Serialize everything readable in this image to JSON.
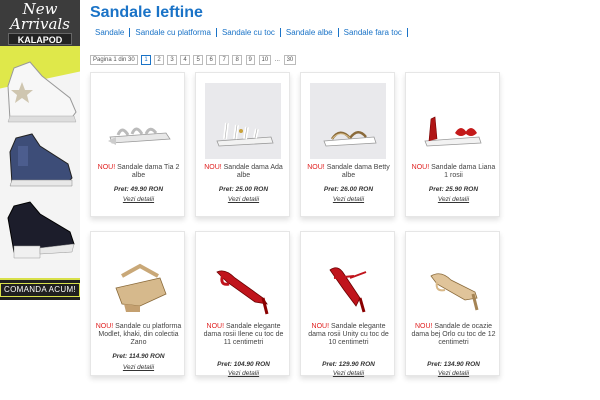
{
  "banner": {
    "title": "New\nArrivals",
    "brand": "KALAPOD",
    "cta": "COMANDA ACUM!"
  },
  "page": {
    "title": "Sandale Ieftine"
  },
  "nav": {
    "links": [
      "Sandale",
      "Sandale cu platforma",
      "Sandale cu toc",
      "Sandale albe",
      "Sandale fara toc"
    ]
  },
  "pager": {
    "label": "Pagina 1 din 30",
    "pages": [
      "1",
      "2",
      "3",
      "4",
      "5",
      "6",
      "7",
      "8",
      "9",
      "10"
    ],
    "dots": "...",
    "last": "30",
    "current": "1"
  },
  "products": [
    {
      "nou": "NOU!",
      "name": "Sandale dama Tia 2 albe",
      "price": "Pret: 49.90 RON",
      "details": "Vezi detalii"
    },
    {
      "nou": "NOU!",
      "name": "Sandale dama Ada albe",
      "price": "Pret: 25.00 RON",
      "details": "Vezi detalii"
    },
    {
      "nou": "NOU!",
      "name": "Sandale dama Betty albe",
      "price": "Pret: 26.00 RON",
      "details": "Vezi detalii"
    },
    {
      "nou": "NOU!",
      "name": "Sandale dama Liana 1 rosii",
      "price": "Pret: 25.90 RON",
      "details": "Vezi detalii"
    },
    {
      "nou": "NOU!",
      "name": "Sandale cu platforma Modlet, khaki, din colectia Zano",
      "price": "Pret: 114.90 RON",
      "details": "Vezi detalii"
    },
    {
      "nou": "NOU!",
      "name": "Sandale elegante dama rosii Ilene cu toc de 11 centimetri",
      "price": "Pret: 104.90 RON",
      "details": "Vezi detalii"
    },
    {
      "nou": "NOU!",
      "name": "Sandale elegante dama rosii Unity cu toc de 10 centimetri",
      "price": "Pret: 129.90 RON",
      "details": "Vezi detalii"
    },
    {
      "nou": "NOU!",
      "name": "Sandale de ocazie dama bej Orlo cu toc de 12 centimetri",
      "price": "Pret: 134.90 RON",
      "details": "Vezi detalii"
    }
  ]
}
